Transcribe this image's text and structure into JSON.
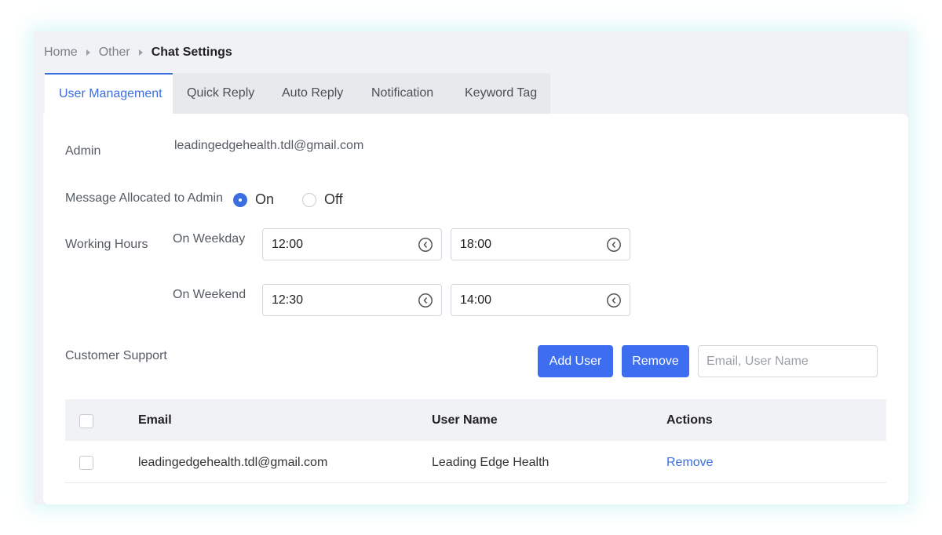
{
  "breadcrumb": {
    "items": [
      "Home",
      "Other"
    ],
    "current": "Chat Settings"
  },
  "tabs": [
    {
      "label": "User Management",
      "active": true
    },
    {
      "label": "Quick Reply",
      "active": false
    },
    {
      "label": "Auto Reply",
      "active": false
    },
    {
      "label": "Notification",
      "active": false
    },
    {
      "label": "Keyword Tag",
      "active": false
    }
  ],
  "admin": {
    "label": "Admin",
    "value": "leadingedgehealth.tdl@gmail.com"
  },
  "message_allocated": {
    "label": "Message Allocated to Admin",
    "options": [
      "On",
      "Off"
    ],
    "selected": "On"
  },
  "working_hours": {
    "label": "Working Hours",
    "weekday": {
      "label": "On Weekday",
      "start": "12:00",
      "end": "18:00"
    },
    "weekend": {
      "label": "On Weekend",
      "start": "12:30",
      "end": "14:00"
    }
  },
  "customer_support": {
    "label": "Customer Support",
    "add_user_label": "Add User",
    "remove_label": "Remove",
    "search_placeholder": "Email, User Name"
  },
  "table": {
    "columns": [
      "Email",
      "User Name",
      "Actions"
    ],
    "rows": [
      {
        "email": "leadingedgehealth.tdl@gmail.com",
        "user_name": "Leading Edge Health",
        "action": "Remove"
      }
    ]
  },
  "colors": {
    "accent": "#3b6fe0",
    "button": "#3d6ef0",
    "panel_bg": "#f1f2f5"
  },
  "icons": {
    "time": "clock-icon",
    "breadcrumb_separator": "caret-right-icon"
  }
}
